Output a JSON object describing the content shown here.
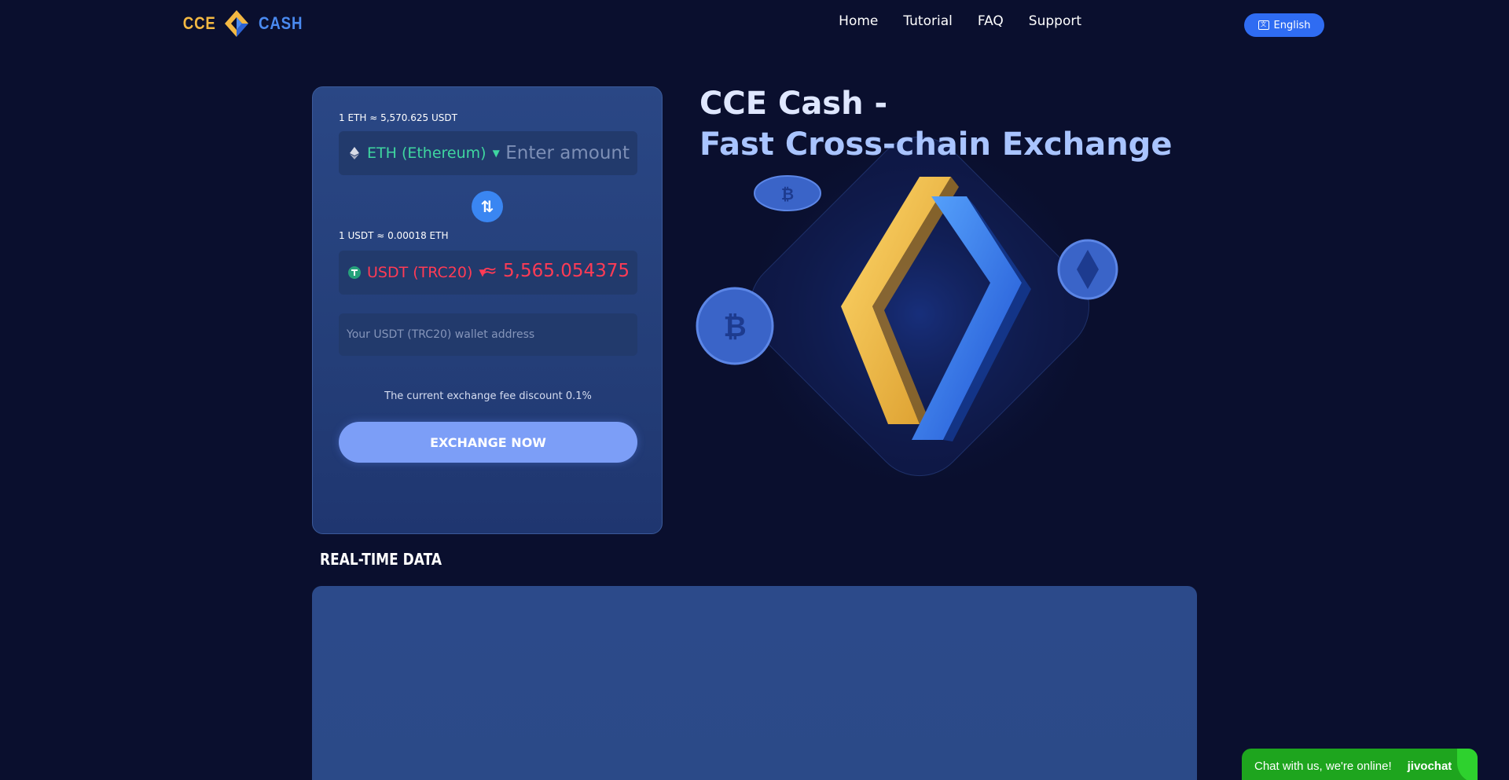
{
  "logo": {
    "left": "CCE",
    "right": "CASH"
  },
  "nav": {
    "home": "Home",
    "tutorial": "Tutorial",
    "faq": "FAQ",
    "support": "Support"
  },
  "language": {
    "label": "English"
  },
  "exchange": {
    "rate_top": "1 ETH ≈ 5,570.625 USDT",
    "from_coin": "ETH (Ethereum)",
    "amount_placeholder": "Enter amount",
    "rate_bottom": "1 USDT ≈ 0.00018 ETH",
    "to_coin": "USDT (TRC20)",
    "result": "≈ 5,565.054375",
    "wallet_placeholder": "Your USDT (TRC20) wallet address",
    "fee_text": "The current exchange fee discount 0.1%",
    "button": "EXCHANGE NOW"
  },
  "hero": {
    "line1": "CCE Cash -",
    "line2": "Fast Cross-chain Exchange"
  },
  "realtime": {
    "title": "REAL-TIME DATA"
  },
  "chat": {
    "text": "Chat with us, we're online!",
    "brand": "jivochat"
  },
  "colors": {
    "background": "#0a0f2e",
    "accent_blue": "#2f6cf2",
    "eth_green": "#3fd6a0",
    "usdt_red": "#ff3b55",
    "logo_gold": "#f3b843",
    "chat_green": "#1ea51e"
  },
  "icons": {
    "from_coin": "ethereum-icon",
    "to_coin": "tether-icon",
    "swap": "swap-arrows-icon",
    "language": "language-icon"
  }
}
